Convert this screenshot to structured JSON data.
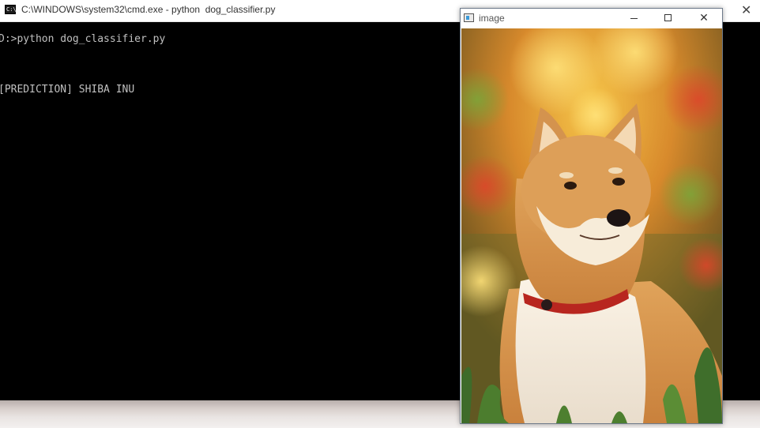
{
  "cmd": {
    "title": "C:\\WINDOWS\\system32\\cmd.exe - python  dog_classifier.py",
    "icon_text": "C:\\",
    "lines": [
      "D:>python dog_classifier.py",
      "",
      "",
      "[PREDICTION] SHIBA INU"
    ]
  },
  "image_window": {
    "title": "image",
    "minimize_icon": "minimize-icon",
    "maximize_icon": "maximize-icon",
    "close_icon": "close-icon",
    "photo": "shiba-inu-dog-photo"
  },
  "colors": {
    "terminal_bg": "#000000",
    "terminal_text": "#c0c0c0",
    "dog_fur": "#d99a52",
    "collar": "#b8261f"
  }
}
